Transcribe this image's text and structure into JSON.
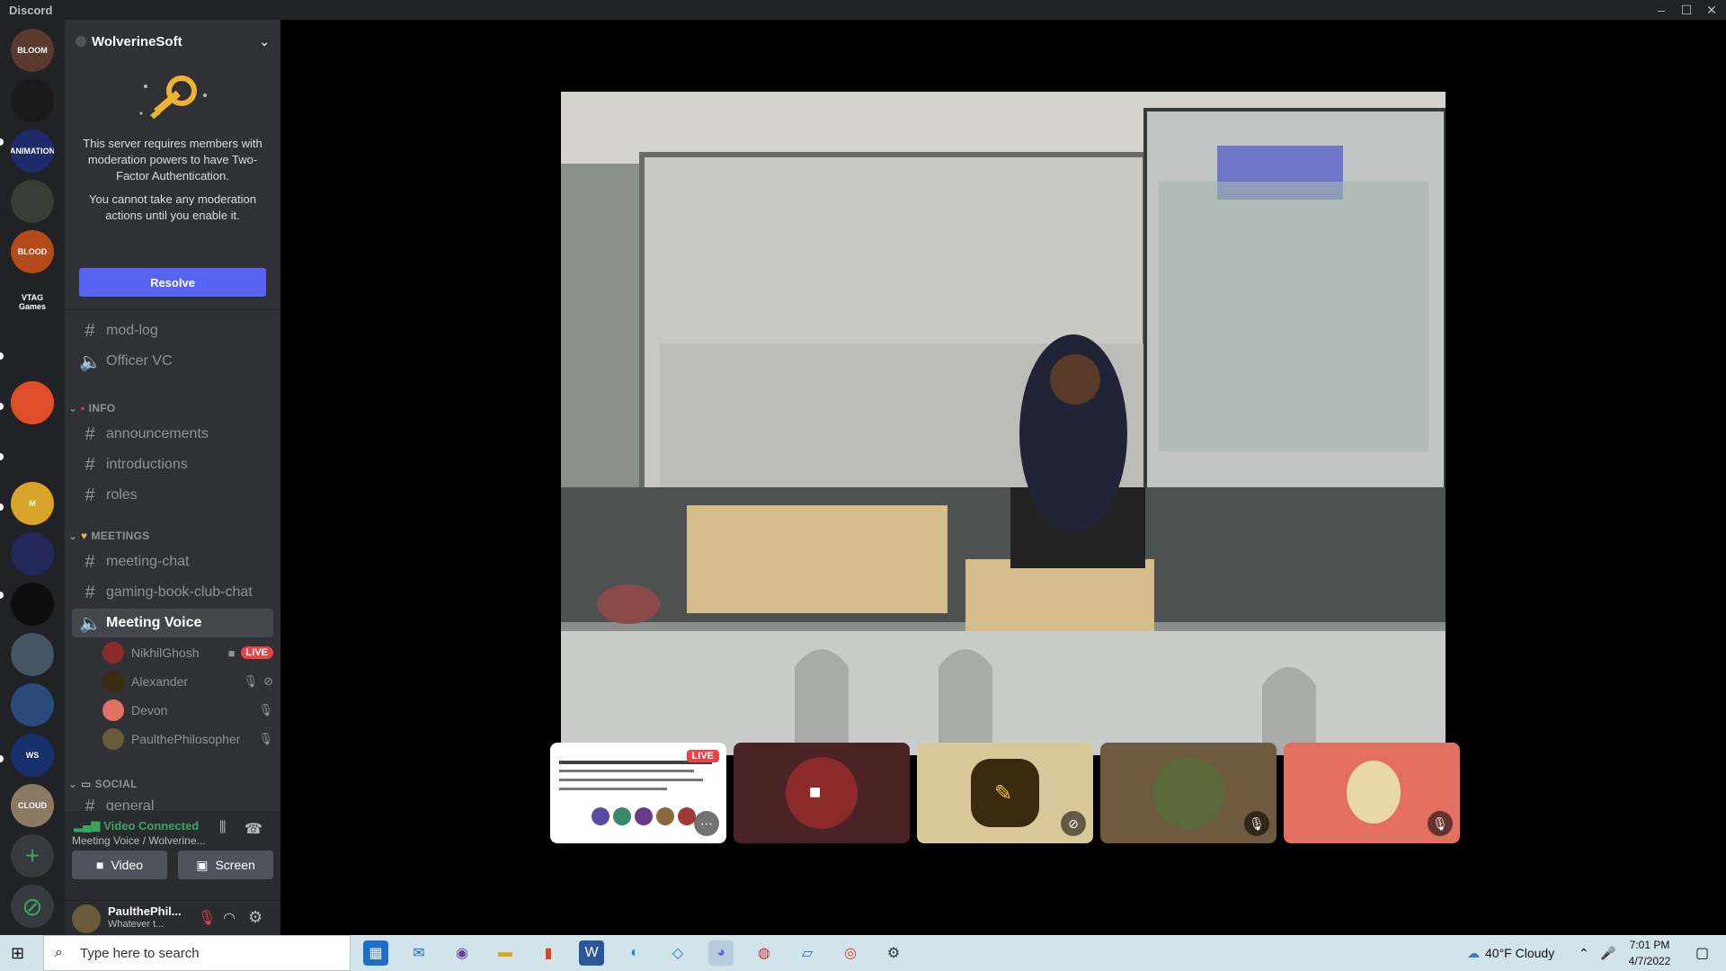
{
  "window": {
    "title": "Discord",
    "minimize": "–",
    "maximize": "☐",
    "close": "✕"
  },
  "servers": [
    {
      "label": "BLOOM",
      "color": "#5b3a2e"
    },
    {
      "label": "",
      "color": "#1a1a1a"
    },
    {
      "label": "ANIMATION",
      "color": "#1d2b6b"
    },
    {
      "label": "",
      "color": "#3a3f35"
    },
    {
      "label": "BLOOD",
      "color": "#b24a1a"
    },
    {
      "label": "VTAG Games",
      "color": "#202225"
    },
    {
      "label": "",
      "color": "#202225"
    },
    {
      "label": "",
      "color": "#e04d2a"
    },
    {
      "label": "",
      "color": "#202225"
    },
    {
      "label": "M",
      "color": "#d8a52a"
    },
    {
      "label": "",
      "color": "#23285a"
    },
    {
      "label": "",
      "color": "#0e0e0e"
    },
    {
      "label": "",
      "color": "#445566"
    },
    {
      "label": "",
      "color": "#2b4a7a"
    },
    {
      "label": "WS",
      "color": "#16306b"
    },
    {
      "label": "CLOUD",
      "color": "#8a7a62"
    }
  ],
  "server_add": "+",
  "server_explore": "⊘",
  "sidebar": {
    "server_name": "WolverineSoft",
    "twofa_message": "This server requires members with moderation powers to have Two-Factor Authentication.",
    "twofa_sub": "You cannot take any moderation actions until you enable it.",
    "resolve_label": "Resolve",
    "channels_top": [
      {
        "name": "mod-log",
        "type": "text"
      },
      {
        "name": "Officer VC",
        "type": "voice"
      }
    ],
    "cat_info": "INFO",
    "channels_info": [
      "announcements",
      "introductions",
      "roles"
    ],
    "cat_meetings": "MEETINGS",
    "channels_meetings": [
      "meeting-chat",
      "gaming-book-club-chat"
    ],
    "active_voice": "Meeting Voice",
    "voice_users": [
      {
        "name": "NikhilGhosh",
        "live": "LIVE",
        "color": "#8a2a2a"
      },
      {
        "name": "Alexander",
        "color": "#3a2a10"
      },
      {
        "name": "Devon",
        "color": "#e07060"
      },
      {
        "name": "PaulthePhilosopher",
        "color": "#6a5a3a"
      }
    ],
    "cat_social": "SOCIAL",
    "channels_social": [
      "general"
    ]
  },
  "voice_panel": {
    "status": "Video Connected",
    "channel": "Meeting Voice / Wolverine...",
    "video_label": "Video",
    "screen_label": "Screen"
  },
  "user_panel": {
    "name": "PaulthePhil...",
    "status": "Whatever t..."
  },
  "tiles": [
    {
      "kind": "screen",
      "live": "LIVE"
    },
    {
      "kind": "camera",
      "bg": "#4a2424"
    },
    {
      "kind": "avatar",
      "bg": "#d9c89a"
    },
    {
      "kind": "avatar",
      "bg": "#6e5a3e"
    },
    {
      "kind": "avatar",
      "bg": "#e26f5f"
    }
  ],
  "taskbar": {
    "search_placeholder": "Type here to search",
    "weather": "40°F  Cloudy",
    "time": "7:01 PM",
    "date": "4/7/2022"
  }
}
